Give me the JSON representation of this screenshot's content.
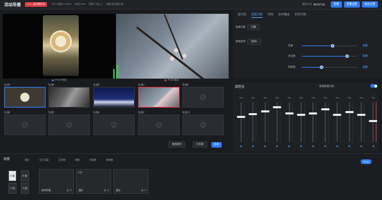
{
  "header": {
    "title": "活动导播",
    "live_badge": "1-1 • 活动预约中",
    "stats": [
      "CPU 使用 21.95%",
      "网络 0ms",
      "码率 733p_1",
      "可推流功能正常"
    ],
    "time_label": "播出时长",
    "time_value": "00:07:33",
    "btn_1": "直播",
    "btn_2": "直播设置",
    "btn_3": "输出设置"
  },
  "preview": {
    "pvw_label": "PVW 预览",
    "pgm_label": "PGM 输出"
  },
  "sources": {
    "row1": [
      "轨道1",
      "轨道2",
      "轨道3",
      "轨道4",
      "轨道5"
    ],
    "row2": [
      "轨道6",
      "轨道7",
      "轨道8",
      "轨道9",
      "轨道10"
    ],
    "select_label": "播放模式",
    "select2_label": "无效果",
    "apply_label": "应用"
  },
  "right_panel": {
    "tabs": [
      "画中画",
      "画面功能",
      "特效",
      "实时播出",
      "花样功能"
    ],
    "row1_label": "画面功能",
    "row1_value": "白嫩",
    "row2_label": "美颜选择",
    "row2_value": "选择1",
    "sliders": [
      {
        "label": "亮度",
        "value": 0.55
      },
      {
        "label": "对比度",
        "value": 0.82
      },
      {
        "label": "饱和度",
        "value": 0.35
      }
    ],
    "reset": "重置"
  },
  "mixer": {
    "title": "调音台",
    "follow_label": "音频跟随切换",
    "channels": [
      "Yes",
      "Yes",
      "Yes",
      "Yes",
      "Yes",
      "Yes",
      "Yes",
      "Yes",
      "Yes",
      "Yes",
      "Yes",
      "Yes"
    ],
    "fader_levels": [
      0.35,
      0.28,
      0.2,
      0.1,
      0.25,
      0.3,
      0.25,
      0.15,
      0.3,
      0.22,
      0.3,
      0.45
    ]
  },
  "bottom": {
    "title": "场景",
    "tools": [
      "图片",
      "文字字幕",
      "文字图",
      "视频",
      "字幕条",
      "音效框"
    ],
    "pvw_btn": "PVW",
    "layers": [
      "A 组",
      "B 组",
      "C 组",
      "D 组"
    ],
    "slots": [
      {
        "name": "如何字幕",
        "label": "标题"
      },
      {
        "name": "图片"
      },
      {
        "name": "图片"
      }
    ]
  }
}
